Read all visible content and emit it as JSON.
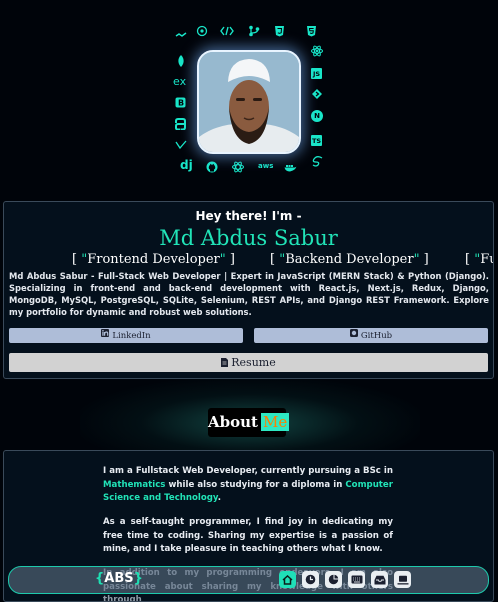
{
  "tech_icons": {
    "top": [
      "chakra-ui-icon",
      "openai-icon",
      "code-icon",
      "git-branch-icon",
      "css3-icon",
      "html5-icon"
    ],
    "left": [
      "mongodb-icon",
      "express-icon",
      "bootstrap-icon",
      "python-icon",
      "selenium-icon"
    ],
    "right": [
      "react-icon",
      "javascript-icon",
      "redux-icon",
      "nextjs-icon",
      "typescript-icon"
    ],
    "bottom": [
      "django-icon",
      "github-icon",
      "openai-icon-2",
      "aws-icon",
      "docker-icon",
      "sass-icon"
    ],
    "labels": {
      "express": "ex",
      "django": "dj",
      "javascript": "JS",
      "typescript": "TS",
      "aws": "aws",
      "nextjs": "N"
    }
  },
  "intro": {
    "greeting": "Hey there! I'm -",
    "name": "Md Abdus Sabur",
    "roles": [
      "Frontend Developer",
      "Backend Developer",
      "Fu"
    ],
    "bio": "Md Abdus Sabur - Full-Stack Web Developer | Expert in JavaScript (MERN Stack) & Python (Django). Specializing in front-end and back-end development with React.js, Next.js, Redux, Django, MongoDB, MySQL, PostgreSQL, SQLite, Selenium, REST APIs, and Django REST Framework. Explore my portfolio for dynamic and robust web solutions.",
    "linkedin_label": "LinkedIn",
    "github_label": "GitHub",
    "resume_label": "Resume"
  },
  "about": {
    "heading_1": "About",
    "heading_2": "Me",
    "p1_a": "I am a Fullstack Web Developer, currently pursuing a BSc in ",
    "p1_b": "Mathematics",
    "p1_c": " while also studying for a diploma in ",
    "p1_d": "Computer Science and Technology",
    "p1_e": ".",
    "p2": "As a self-taught programmer, I find joy in dedicating my free time to coding. Sharing my expertise is a passion of mine, and I take pleasure in teaching others what I know.",
    "p3": "In addition to my programming endeavors, I am also passionate about sharing my knowledge with others through"
  },
  "nav": {
    "logo_open": "{",
    "logo_text": "ABS",
    "logo_close": "}",
    "items": [
      "home-icon",
      "clock-icon",
      "pie-chart-icon",
      "keyboard-icon",
      "inbox-icon",
      "laptop-icon"
    ]
  },
  "colors": {
    "accent": "#21e3b7",
    "background": "#00040a",
    "card": "#04101c"
  }
}
